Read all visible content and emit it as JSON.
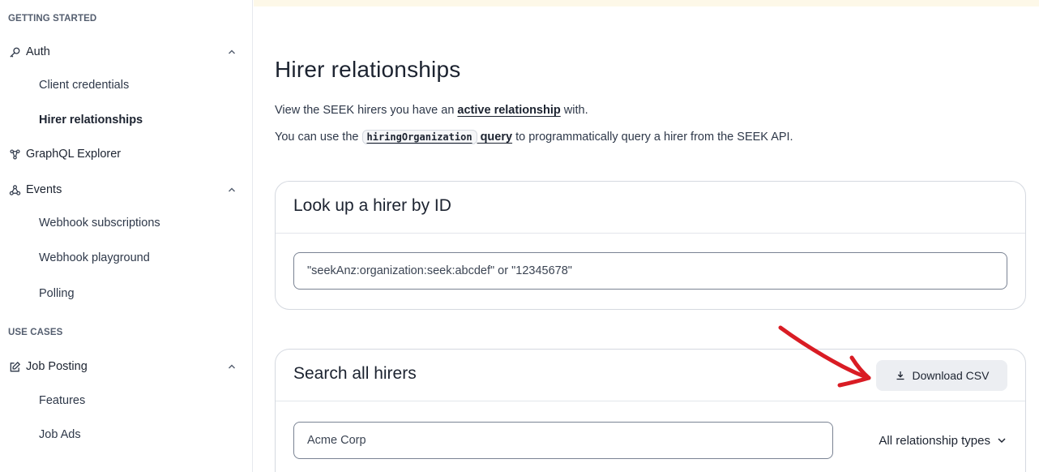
{
  "sidebar": {
    "getting_started_heading": "GETTING STARTED",
    "use_cases_heading": "USE CASES",
    "auth": {
      "label": "Auth",
      "icon": "key-icon"
    },
    "auth_children": [
      "Client credentials",
      "Hirer relationships"
    ],
    "graphql": {
      "label": "GraphQL Explorer",
      "icon": "graphql-icon"
    },
    "events": {
      "label": "Events",
      "icon": "webhook-icon"
    },
    "events_children": [
      "Webhook subscriptions",
      "Webhook playground",
      "Polling"
    ],
    "job_posting": {
      "label": "Job Posting",
      "icon": "edit-icon"
    },
    "job_posting_children": [
      "Features",
      "Job Ads"
    ]
  },
  "main": {
    "title": "Hirer relationships",
    "para1_prefix": "View the SEEK hirers you have an ",
    "para1_link": "active relationship",
    "para1_suffix": " with.",
    "para2_prefix": "You can use the ",
    "para2_code": "hiringOrganization",
    "para2_link": " query",
    "para2_suffix": " to programmatically query a hirer from the SEEK API.",
    "lookup_card": {
      "title": "Look up a hirer by ID",
      "input_value": "\"seekAnz:organization:seek:abcdef\" or \"12345678\""
    },
    "search_card": {
      "title": "Search all hirers",
      "download_label": "Download CSV",
      "input_value": "Acme Corp",
      "select_value": "All relationship types"
    },
    "annotation_color": "#d91c24"
  }
}
